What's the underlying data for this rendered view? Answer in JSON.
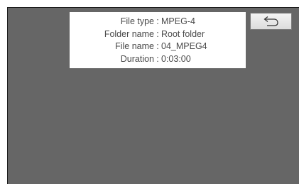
{
  "file_info": {
    "rows": [
      {
        "label": "File type",
        "separator": ":",
        "value": "MPEG-4"
      },
      {
        "label": "Folder name",
        "separator": ":",
        "value": "Root folder"
      },
      {
        "label": "File name",
        "separator": ":",
        "value": "04_MPEG4"
      },
      {
        "label": "Duration",
        "separator": ":",
        "value": "0:03:00"
      }
    ]
  },
  "back_button": {
    "icon": "return-arrow-icon"
  },
  "colors": {
    "screen_background": "#666666",
    "panel_background": "#ffffff",
    "text": "#4a4a4a"
  }
}
